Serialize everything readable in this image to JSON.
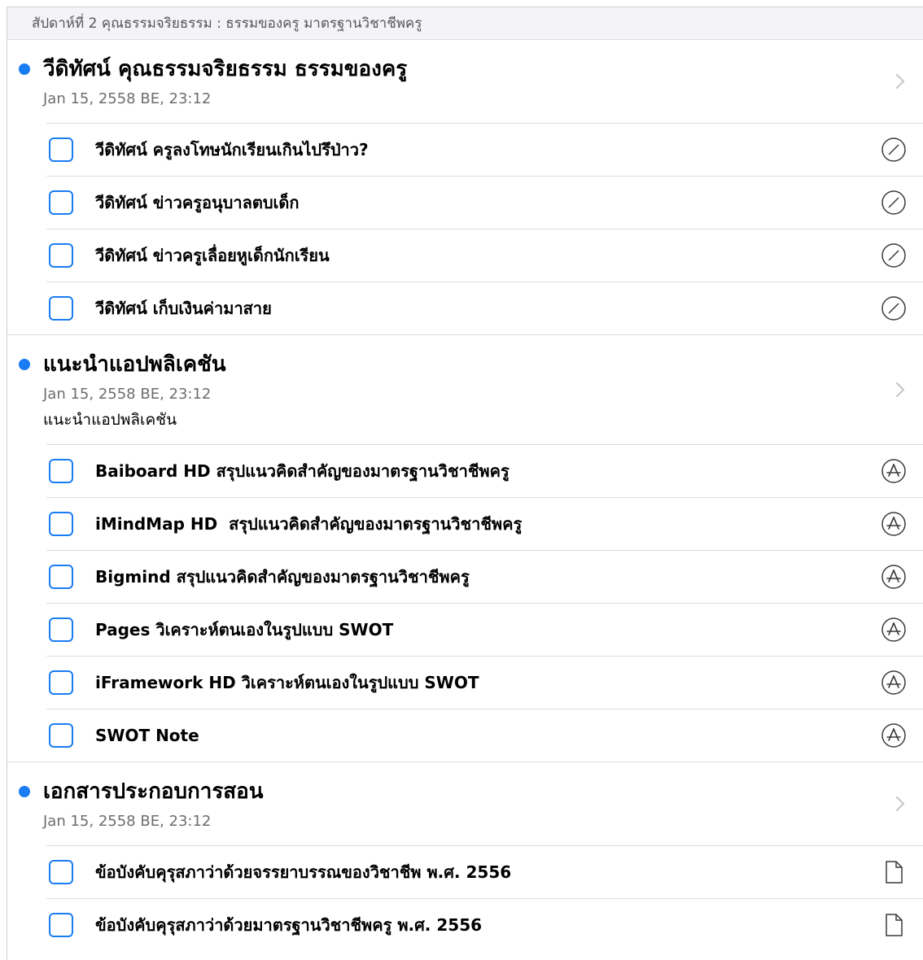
{
  "section": {
    "title": "สัปดาห์ที่ 2 คุณธรรมจริยธรรม : ธรรมของครู มาตรฐานวิชาชีพครู"
  },
  "colors": {
    "accent": "#1a7cf2",
    "separator": "#dcdce0",
    "header_bg": "#f4f4f6",
    "secondary_text": "#6d6d72"
  },
  "groups": [
    {
      "title": "วีดิทัศน์ คุณธรรมจริยธรรม ธรรมของครู",
      "date": "Jan 15, 2558 BE, 23:12",
      "items": [
        {
          "label": "วีดิทัศน์ ครูลงโทษนักเรียนเกินไปรึป่าว?",
          "icon": "safari-compass-icon"
        },
        {
          "label": "วีดิทัศน์ ข่าวครูอนุบาลตบเด็ก",
          "icon": "safari-compass-icon"
        },
        {
          "label": "วีดิทัศน์ ข่าวครูเลื่อยหูเด็กนักเรียน",
          "icon": "safari-compass-icon"
        },
        {
          "label": "วีดิทัศน์ เก็บเงินค่ามาสาย",
          "icon": "safari-compass-icon"
        }
      ]
    },
    {
      "title": "แนะนำแอปพลิเคชัน",
      "date": "Jan 15, 2558 BE, 23:12",
      "description": "แนะนำแอปพลิเคชัน",
      "items": [
        {
          "label": "Baiboard HD สรุปแนวคิดสำคัญของมาตรฐานวิชาชีพครู",
          "icon": "app-store-icon"
        },
        {
          "label": "iMindMap HD  สรุปแนวคิดสำคัญของมาตรฐานวิชาชีพครู",
          "icon": "app-store-icon"
        },
        {
          "label": "Bigmind สรุปแนวคิดสำคัญของมาตรฐานวิชาชีพครู",
          "icon": "app-store-icon"
        },
        {
          "label": "Pages วิเคราะห์ตนเองในรูปแบบ SWOT",
          "icon": "app-store-icon"
        },
        {
          "label": "iFramework HD วิเคราะห์ตนเองในรูปแบบ SWOT",
          "icon": "app-store-icon"
        },
        {
          "label": "SWOT Note",
          "icon": "app-store-icon"
        }
      ]
    },
    {
      "title": "เอกสารประกอบการสอน",
      "date": "Jan 15, 2558 BE, 23:12",
      "items": [
        {
          "label": "ข้อบังคับคุรุสภาว่าด้วยจรรยาบรรณของวิชาชีพ พ.ศ. 2556",
          "icon": "document-icon"
        },
        {
          "label": "ข้อบังคับคุรุสภาว่าด้วยมาตรฐานวิชาชีพครู พ.ศ. 2556",
          "icon": "document-icon"
        }
      ]
    }
  ]
}
